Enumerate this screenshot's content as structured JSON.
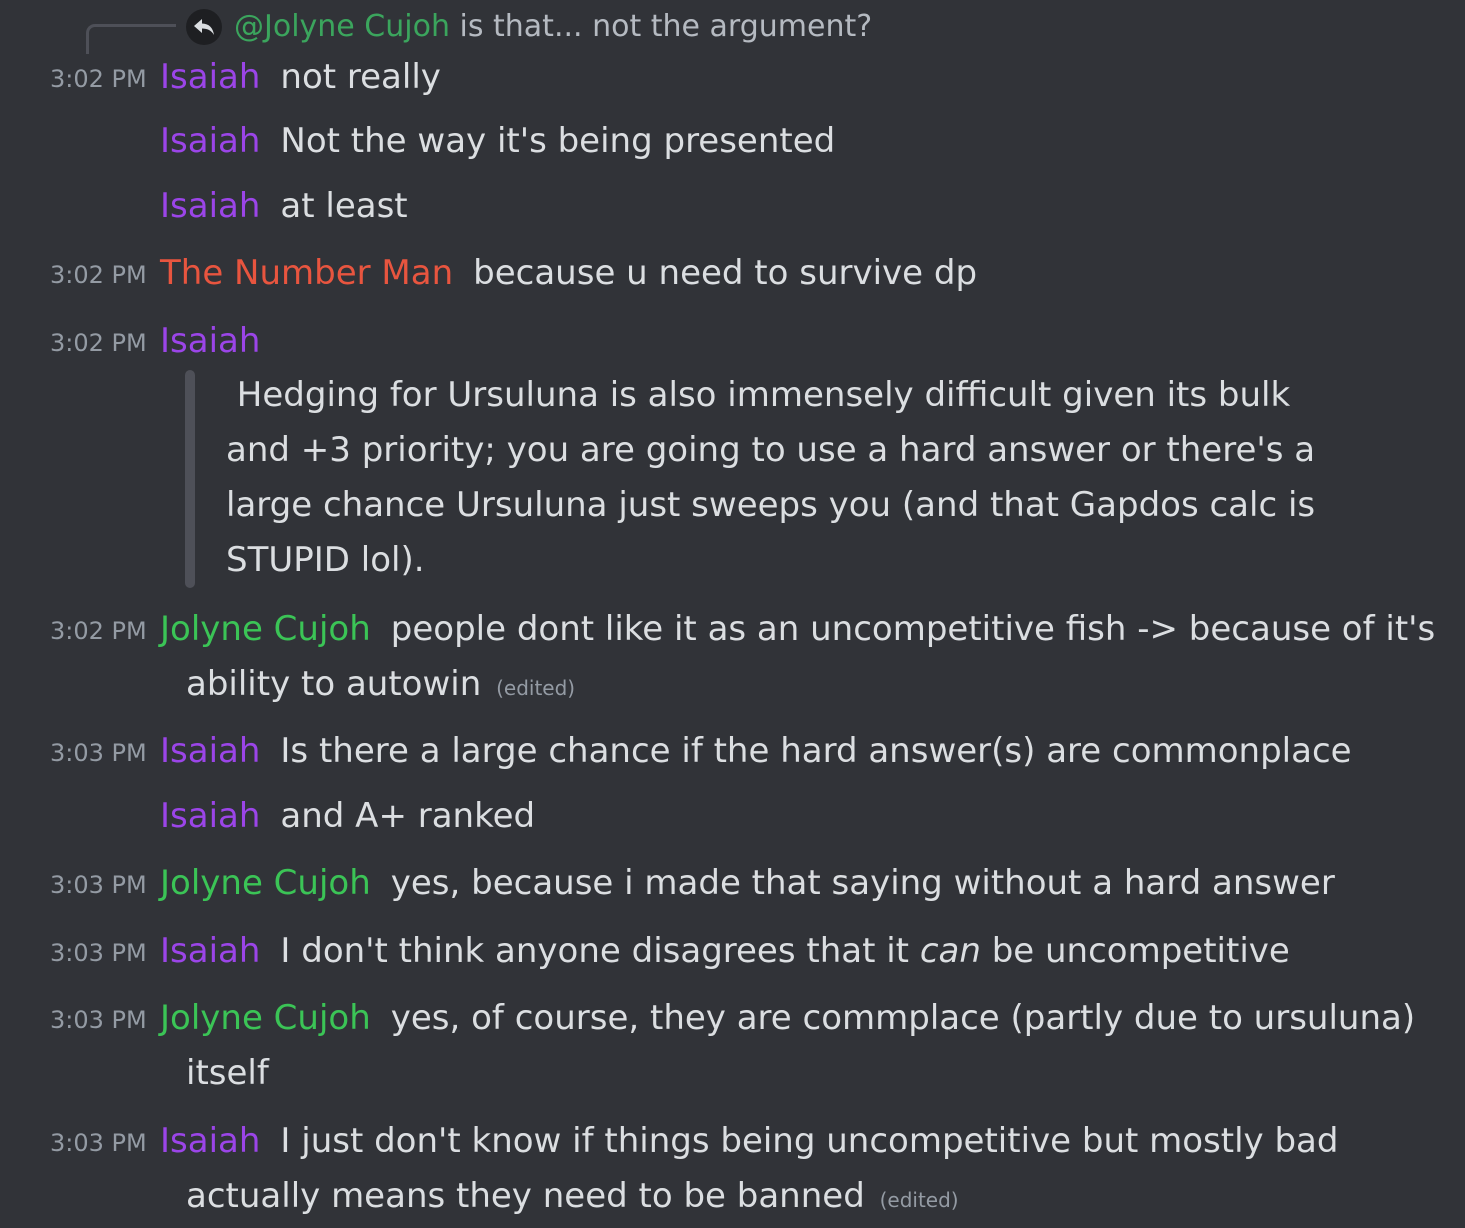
{
  "reply": {
    "mention": "@Jolyne Cujoh",
    "text": "is that... not the argument?"
  },
  "messages": [
    {
      "time": "3:02 PM",
      "author": "Isaiah",
      "text": "not really"
    },
    {
      "author": "Isaiah",
      "text": "Not the way it's being presented"
    },
    {
      "author": "Isaiah",
      "text": "at least"
    },
    {
      "time": "3:02 PM",
      "author": "The Number Man",
      "text": "because u need to survive dp"
    },
    {
      "time": "3:02 PM",
      "author": "Isaiah",
      "quote_lines": [
        " Hedging for Ursuluna is also immensely difficult given its bulk",
        "and +3 priority; you are going to use a hard answer or there's a",
        "large chance Ursuluna just sweeps you (and that Gapdos calc is",
        "STUPID lol)."
      ]
    },
    {
      "time": "3:02 PM",
      "author": "Jolyne Cujoh",
      "text": "people dont like it as an uncompetitive fish -> because of it's",
      "continuation": "ability to autowin",
      "edited": "(edited)"
    },
    {
      "time": "3:03 PM",
      "author": "Isaiah",
      "text": "Is there a large chance if the hard answer(s) are commonplace"
    },
    {
      "author": "Isaiah",
      "text": "and A+ ranked"
    },
    {
      "time": "3:03 PM",
      "author": "Jolyne Cujoh",
      "text": "yes, because i made that saying without a hard answer"
    },
    {
      "time": "3:03 PM",
      "author": "Isaiah",
      "text_before": "I don't think anyone disagrees that it ",
      "text_em": "can",
      "text_after": " be uncompetitive"
    },
    {
      "time": "3:03 PM",
      "author": "Jolyne Cujoh",
      "text": "yes, of course, they are commplace (partly due to ursuluna)",
      "continuation": "itself"
    },
    {
      "time": "3:03 PM",
      "author": "Isaiah",
      "text": "I just don't know if things being uncompetitive but mostly bad",
      "continuation": "actually means they need to be banned",
      "edited": "(edited)"
    }
  ],
  "colors": {
    "background": "#313338",
    "isaiah": "#9b45e8",
    "number_man": "#e8553f",
    "jolyne": "#3bc456",
    "mention": "#3ba55d"
  }
}
